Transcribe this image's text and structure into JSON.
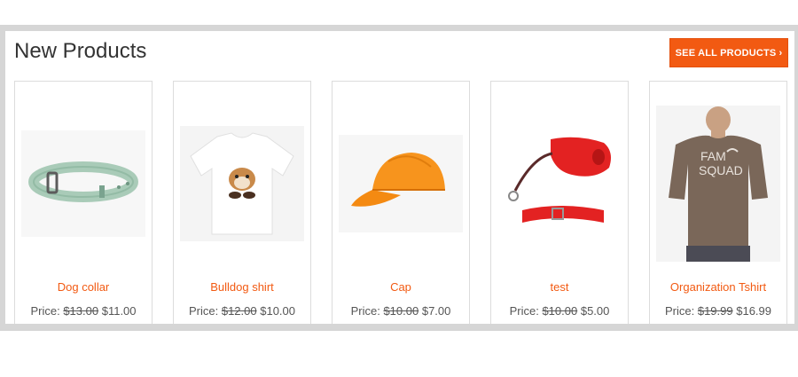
{
  "section": {
    "title": "New Products",
    "see_all_label": "SEE ALL PRODUCTS",
    "see_all_chevron": "›",
    "accent_color": "#f25a12"
  },
  "products": [
    {
      "name": "Dog collar",
      "price_label": "Price:",
      "old_price": "$13.00",
      "new_price": "$11.00",
      "image": "dog-collar-image"
    },
    {
      "name": "Bulldog shirt",
      "price_label": "Price:",
      "old_price": "$12.00",
      "new_price": "$10.00",
      "image": "bulldog-shirt-image"
    },
    {
      "name": "Cap",
      "price_label": "Price:",
      "old_price": "$10.00",
      "new_price": "$7.00",
      "image": "cap-image"
    },
    {
      "name": "test",
      "price_label": "Price:",
      "old_price": "$10.00",
      "new_price": "$5.00",
      "image": "leash-image"
    },
    {
      "name": "Organization Tshirt",
      "price_label": "Price:",
      "old_price": "$19.99",
      "new_price": "$16.99",
      "image": "tshirt-image"
    }
  ]
}
